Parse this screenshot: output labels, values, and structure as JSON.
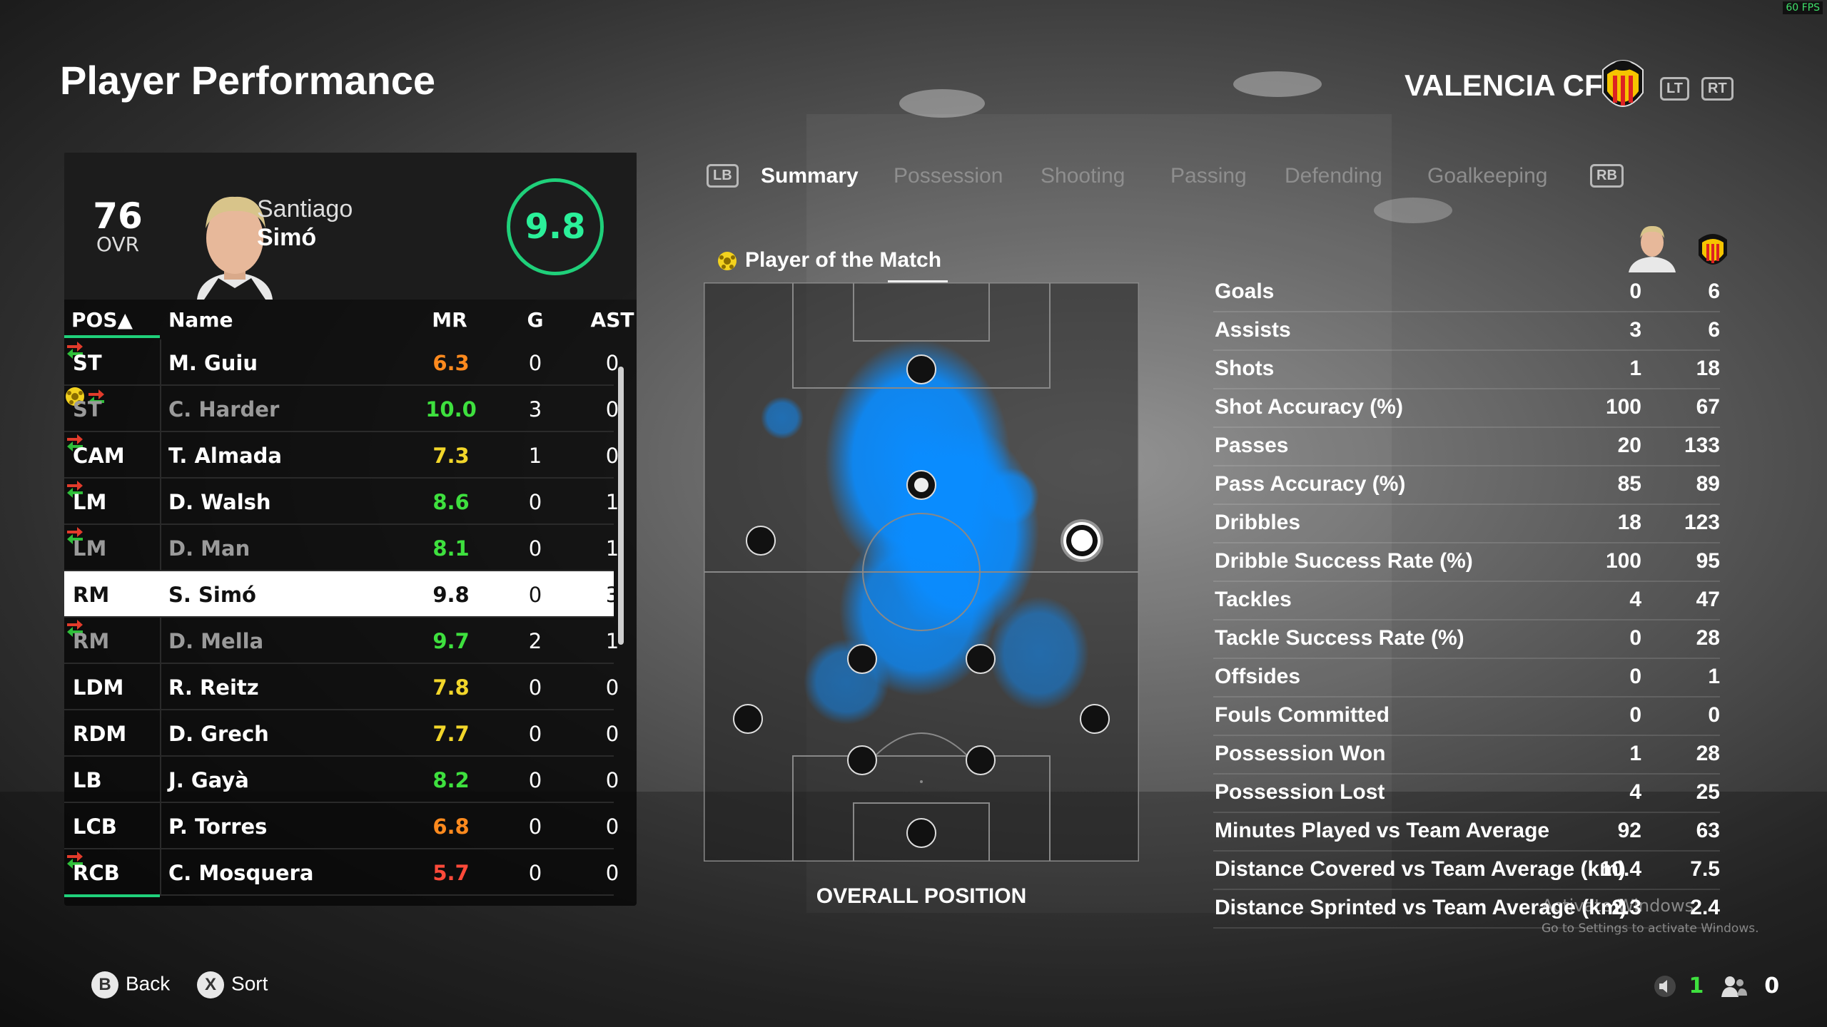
{
  "fps": "60 FPS",
  "header": {
    "title": "Player Performance",
    "team_name": "VALENCIA CF",
    "lt_label": "LT",
    "rt_label": "RT"
  },
  "player": {
    "ovr": "76",
    "ovr_label": "OVR",
    "first_name": "Santiago",
    "last_name": "Simó",
    "rating": "9.8"
  },
  "table": {
    "headers": {
      "pos": "POS▲",
      "name": "Name",
      "mr": "MR",
      "g": "G",
      "ast": "AST"
    },
    "rows": [
      {
        "pos": "ST",
        "name": "M. Guiu",
        "mr": "6.3",
        "g": "0",
        "ast": "0",
        "color": "#ff8a1e",
        "sub": true,
        "dim": false,
        "potm": false
      },
      {
        "pos": "ST",
        "name": "C. Harder",
        "mr": "10.0",
        "g": "3",
        "ast": "0",
        "color": "#3ee03e",
        "sub": true,
        "dim": true,
        "potm": true
      },
      {
        "pos": "CAM",
        "name": "T. Almada",
        "mr": "7.3",
        "g": "1",
        "ast": "0",
        "color": "#f2d62a",
        "sub": true,
        "dim": false,
        "potm": false
      },
      {
        "pos": "LM",
        "name": "D. Walsh",
        "mr": "8.6",
        "g": "0",
        "ast": "1",
        "color": "#3ee03e",
        "sub": true,
        "dim": false,
        "potm": false
      },
      {
        "pos": "LM",
        "name": "D. Man",
        "mr": "8.1",
        "g": "0",
        "ast": "1",
        "color": "#3ee03e",
        "sub": true,
        "dim": true,
        "potm": false
      },
      {
        "pos": "RM",
        "name": "S. Simó",
        "mr": "9.8",
        "g": "0",
        "ast": "3",
        "color": "#111111",
        "sub": false,
        "dim": false,
        "potm": false,
        "selected": true
      },
      {
        "pos": "RM",
        "name": "D. Mella",
        "mr": "9.7",
        "g": "2",
        "ast": "1",
        "color": "#3ee03e",
        "sub": true,
        "dim": true,
        "potm": false
      },
      {
        "pos": "LDM",
        "name": "R. Reitz",
        "mr": "7.8",
        "g": "0",
        "ast": "0",
        "color": "#f2d62a",
        "sub": false,
        "dim": false,
        "potm": false
      },
      {
        "pos": "RDM",
        "name": "D. Grech",
        "mr": "7.7",
        "g": "0",
        "ast": "0",
        "color": "#f2d62a",
        "sub": false,
        "dim": false,
        "potm": false
      },
      {
        "pos": "LB",
        "name": "J. Gayà",
        "mr": "8.2",
        "g": "0",
        "ast": "0",
        "color": "#3ee03e",
        "sub": false,
        "dim": false,
        "potm": false
      },
      {
        "pos": "LCB",
        "name": "P. Torres",
        "mr": "6.8",
        "g": "0",
        "ast": "0",
        "color": "#ff8a1e",
        "sub": false,
        "dim": false,
        "potm": false
      },
      {
        "pos": "RCB",
        "name": "C. Mosquera",
        "mr": "5.7",
        "g": "0",
        "ast": "0",
        "color": "#ff4a3a",
        "sub": true,
        "dim": false,
        "potm": false
      }
    ]
  },
  "tabs": {
    "lb": "LB",
    "rb": "RB",
    "items": [
      "Summary",
      "Possession",
      "Shooting",
      "Passing",
      "Defending",
      "Goalkeeping"
    ],
    "active": "Summary"
  },
  "potm_label": "Player of the Match",
  "overall_position_label": "OVERALL POSITION",
  "stats": [
    {
      "label": "Goals",
      "player": "0",
      "team": "6"
    },
    {
      "label": "Assists",
      "player": "3",
      "team": "6"
    },
    {
      "label": "Shots",
      "player": "1",
      "team": "18"
    },
    {
      "label": "Shot Accuracy (%)",
      "player": "100",
      "team": "67"
    },
    {
      "label": "Passes",
      "player": "20",
      "team": "133"
    },
    {
      "label": "Pass Accuracy (%)",
      "player": "85",
      "team": "89"
    },
    {
      "label": "Dribbles",
      "player": "18",
      "team": "123"
    },
    {
      "label": "Dribble Success Rate (%)",
      "player": "100",
      "team": "95"
    },
    {
      "label": "Tackles",
      "player": "4",
      "team": "47"
    },
    {
      "label": "Tackle Success Rate (%)",
      "player": "0",
      "team": "28"
    },
    {
      "label": "Offsides",
      "player": "0",
      "team": "1"
    },
    {
      "label": "Fouls Committed",
      "player": "0",
      "team": "0"
    },
    {
      "label": "Possession Won",
      "player": "1",
      "team": "28"
    },
    {
      "label": "Possession Lost",
      "player": "4",
      "team": "25"
    },
    {
      "label": "Minutes Played vs Team Average",
      "player": "92",
      "team": "63"
    },
    {
      "label": "Distance Covered vs Team Average (km)",
      "player": "10.4",
      "team": "7.5"
    },
    {
      "label": "Distance Sprinted vs Team Average (km)",
      "player": "2.3",
      "team": "2.4"
    }
  ],
  "watermark": {
    "line1": "Activate Windows",
    "line2": "Go to Settings to activate Windows."
  },
  "footer": {
    "b_label": "B",
    "back": "Back",
    "x_label": "X",
    "sort": "Sort",
    "count_green": "1",
    "count_white": "0"
  }
}
